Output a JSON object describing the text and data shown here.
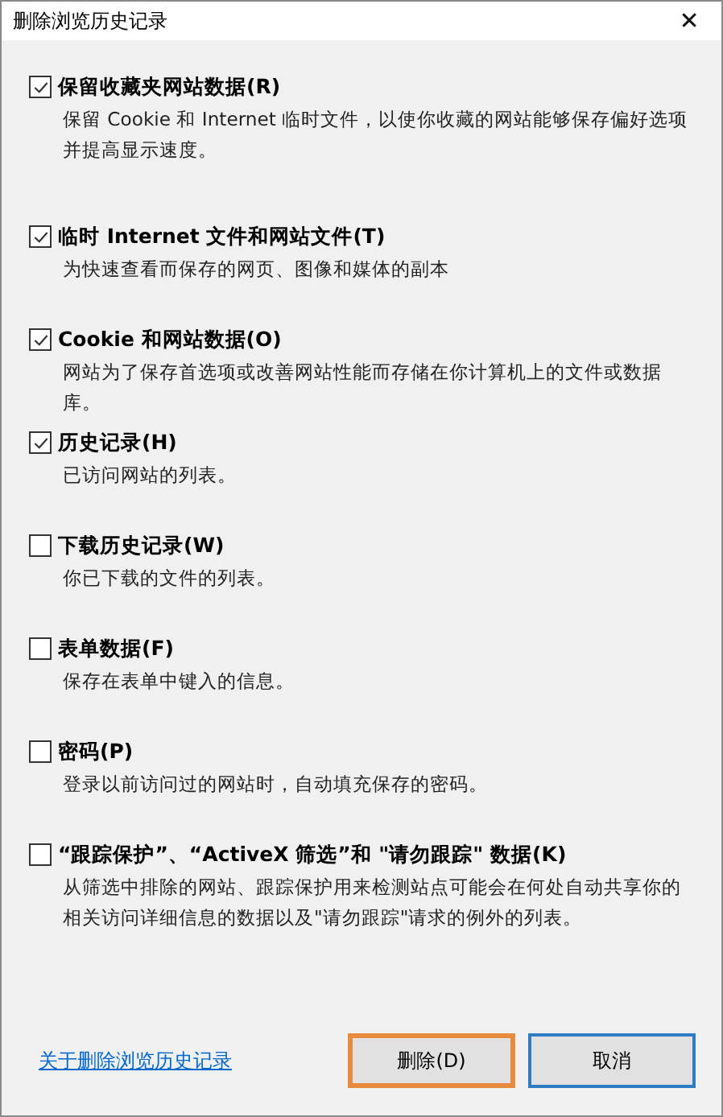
{
  "window": {
    "title": "删除浏览历史记录",
    "close": "✕"
  },
  "options": [
    {
      "label": "保留收藏夹网站数据(R)",
      "checked": true,
      "description": "保留 Cookie 和 Internet 临时文件，以使你收藏的网站能够保存偏好选项并提高显示速度。"
    },
    {
      "label": "临时 Internet 文件和网站文件(T)",
      "checked": true,
      "description": "为快速查看而保存的网页、图像和媒体的副本"
    },
    {
      "label": "Cookie 和网站数据(O)",
      "checked": true,
      "description": "网站为了保存首选项或改善网站性能而存储在你计算机上的文件或数据库。"
    },
    {
      "label": "历史记录(H)",
      "checked": true,
      "description": "已访问网站的列表。"
    },
    {
      "label": "下载历史记录(W)",
      "checked": false,
      "description": "你已下载的文件的列表。"
    },
    {
      "label": "表单数据(F)",
      "checked": false,
      "description": "保存在表单中键入的信息。"
    },
    {
      "label": "密码(P)",
      "checked": false,
      "description": "登录以前访问过的网站时，自动填充保存的密码。"
    },
    {
      "label": "“跟踪保护”、“ActiveX 筛选”和 \"请勿跟踪\" 数据(K)",
      "checked": false,
      "description": "从筛选中排除的网站、跟踪保护用来检测站点可能会在何处自动共享你的相关访问详细信息的数据以及\"请勿跟踪\"请求的例外的列表。"
    }
  ],
  "footer": {
    "link": "关于删除浏览历史记录",
    "buttons": [
      {
        "label": "删除(D)",
        "highlighted": true,
        "default": false
      },
      {
        "label": "取消",
        "highlighted": false,
        "default": true
      }
    ]
  }
}
